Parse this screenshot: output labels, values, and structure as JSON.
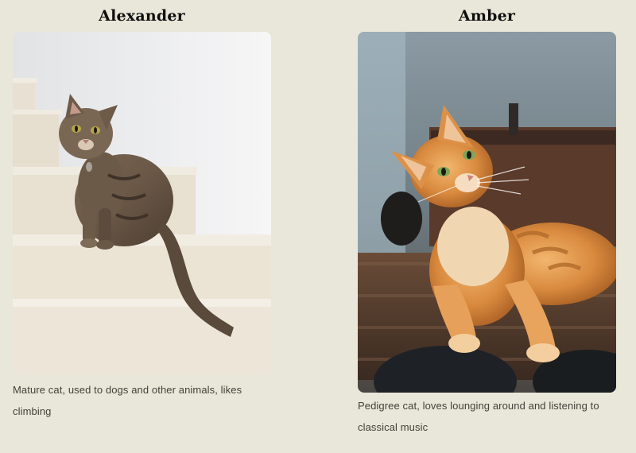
{
  "pets": [
    {
      "name": "Alexander",
      "description": "Mature cat, used to dogs and other animals, likes climbing",
      "photo_icon": "tabby-cat-on-stairs-photo"
    },
    {
      "name": "Amber",
      "description": "Pedigree cat, loves lounging around and listening to classical music",
      "photo_icon": "ginger-cat-on-table-photo"
    }
  ],
  "colors": {
    "page_background": "#e9e7d9",
    "heading": "#0f0f0f",
    "body_text": "#44403a"
  }
}
